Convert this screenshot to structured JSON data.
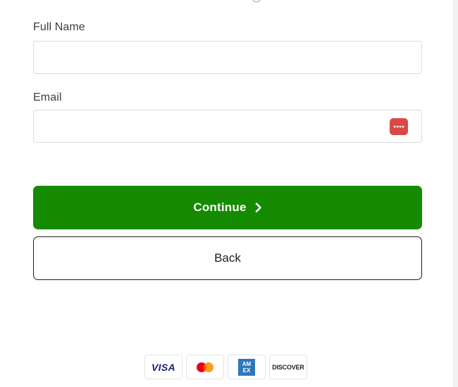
{
  "form": {
    "full_name": {
      "label": "Full Name",
      "value": "",
      "placeholder": ""
    },
    "email": {
      "label": "Email",
      "value": "",
      "placeholder": "",
      "password_manager_icon": "password-manager-dots-icon"
    }
  },
  "buttons": {
    "continue_label": "Continue",
    "continue_icon": "chevron-right-icon",
    "back_label": "Back"
  },
  "payment_cards": {
    "visa": "VISA",
    "mastercard": "mastercard-logo",
    "amex_top": "AM",
    "amex_bottom": "EX",
    "discover": "DISCOVER"
  },
  "colors": {
    "primary_button": "#168a01",
    "password_badge": "#d94a45",
    "amex_blue": "#2e77bc",
    "visa_blue": "#1a1f71"
  }
}
